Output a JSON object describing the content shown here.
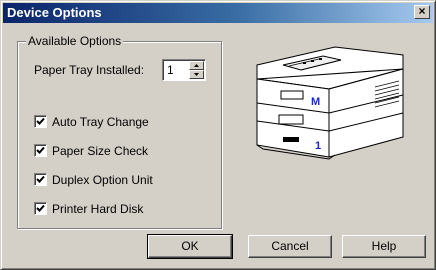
{
  "window": {
    "title": "Device Options",
    "close_glyph": "×"
  },
  "group": {
    "label": "Available Options",
    "tray_label": "Paper Tray Installed:",
    "tray_value": "1",
    "options": [
      {
        "label": "Auto Tray Change",
        "checked": true
      },
      {
        "label": "Paper Size Check",
        "checked": true
      },
      {
        "label": "Duplex Option Unit",
        "checked": true
      },
      {
        "label": "Printer Hard Disk",
        "checked": true
      }
    ]
  },
  "printer": {
    "upper_tray_mark": "M",
    "lower_tray_mark": "1",
    "mark_color": "#1a2cc8"
  },
  "buttons": {
    "ok": "OK",
    "cancel": "Cancel",
    "help": "Help"
  },
  "icons": {
    "close": "close-icon",
    "spin_up": "triangle-up-icon",
    "spin_down": "triangle-down-icon",
    "check": "checkmark-icon"
  },
  "colors": {
    "title_start": "#0a246a",
    "title_end": "#a6caf0",
    "face": "#d4d0c8"
  }
}
